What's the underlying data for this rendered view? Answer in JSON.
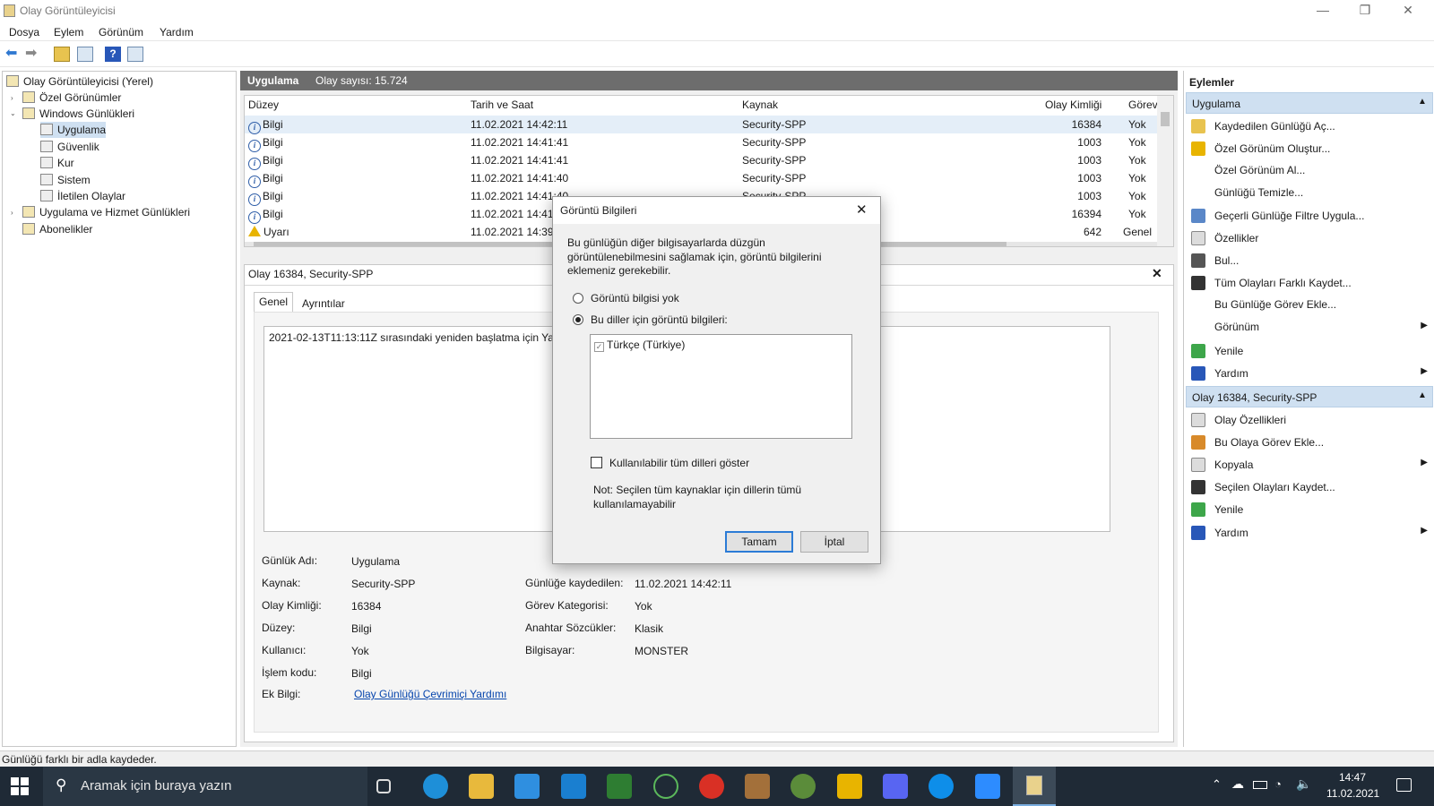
{
  "app": {
    "title": "Olay Görüntüleyicisi"
  },
  "menu": [
    "Dosya",
    "Eylem",
    "Görünüm",
    "Yardım"
  ],
  "tree": {
    "root": "Olay Görüntüleyicisi (Yerel)",
    "custom_views": "Özel Görünümler",
    "windows_logs": "Windows Günlükleri",
    "items": [
      "Uygulama",
      "Güvenlik",
      "Kur",
      "Sistem",
      "İletilen Olaylar"
    ],
    "app_service_logs": "Uygulama ve Hizmet Günlükleri",
    "subscriptions": "Abonelikler"
  },
  "log_header": {
    "name": "Uygulama",
    "count_text": "Olay sayısı: 15.724"
  },
  "grid": {
    "columns": [
      "Düzey",
      "Tarih ve Saat",
      "Kaynak",
      "Olay Kimliği",
      "Görev"
    ],
    "rows": [
      {
        "level": "Bilgi",
        "date": "11.02.2021 14:42:11",
        "source": "Security-SPP",
        "id": "16384",
        "task": "Yok"
      },
      {
        "level": "Bilgi",
        "date": "11.02.2021 14:41:41",
        "source": "Security-SPP",
        "id": "1003",
        "task": "Yok"
      },
      {
        "level": "Bilgi",
        "date": "11.02.2021 14:41:41",
        "source": "Security-SPP",
        "id": "1003",
        "task": "Yok"
      },
      {
        "level": "Bilgi",
        "date": "11.02.2021 14:41:40",
        "source": "Security-SPP",
        "id": "1003",
        "task": "Yok"
      },
      {
        "level": "Bilgi",
        "date": "11.02.2021 14:41:40",
        "source": "Security-SPP",
        "id": "1003",
        "task": "Yok"
      },
      {
        "level": "Bilgi",
        "date": "11.02.2021 14:41:",
        "source": "",
        "id": "16394",
        "task": "Yok"
      },
      {
        "level": "Uyarı",
        "date": "11.02.2021 14:39",
        "source": "",
        "id": "642",
        "task": "Genel"
      }
    ]
  },
  "detail": {
    "title": "Olay 16384, Security-SPP",
    "tabs": [
      "Genel",
      "Ayrıntılar"
    ],
    "message": "2021-02-13T11:13:11Z sırasındaki yeniden başlatma için Ya",
    "labels": {
      "log_name": "Günlük Adı:",
      "source": "Kaynak:",
      "event_id": "Olay Kimliği:",
      "level": "Düzey:",
      "user": "Kullanıcı:",
      "opcode": "İşlem kodu:",
      "more_info": "Ek Bilgi:",
      "logged": "Günlüğe kaydedilen:",
      "task_category": "Görev Kategorisi:",
      "keywords": "Anahtar Sözcükler:",
      "computer": "Bilgisayar:"
    },
    "values": {
      "log_name": "Uygulama",
      "source": "Security-SPP",
      "event_id": "16384",
      "level": "Bilgi",
      "user": "Yok",
      "opcode": "Bilgi",
      "more_info": "Olay Günlüğü Çevrimiçi Yardımı",
      "logged": "11.02.2021 14:42:11",
      "task_category": "Yok",
      "keywords": "Klasik",
      "computer": "MONSTER"
    }
  },
  "actions": {
    "header": "Eylemler",
    "section1": "Uygulama",
    "items1": [
      "Kaydedilen Günlüğü Aç...",
      "Özel Görünüm Oluştur...",
      "Özel Görünüm Al...",
      "Günlüğü Temizle...",
      "Geçerli Günlüğe Filtre Uygula...",
      "Özellikler",
      "Bul...",
      "Tüm Olayları Farklı Kaydet...",
      "Bu Günlüğe Görev Ekle...",
      "Görünüm",
      "Yenile",
      "Yardım"
    ],
    "section2": "Olay 16384, Security-SPP",
    "items2": [
      "Olay Özellikleri",
      "Bu Olaya Görev Ekle...",
      "Kopyala",
      "Seçilen Olayları Kaydet...",
      "Yenile",
      "Yardım"
    ]
  },
  "dialog": {
    "title": "Görüntü Bilgileri",
    "description": "Bu günlüğün diğer bilgisayarlarda düzgün görüntülenebilmesini sağlamak için, görüntü bilgilerini eklemeniz gerekebilir.",
    "option_none": "Görüntü bilgisi yok",
    "option_langs": "Bu diller için görüntü bilgileri:",
    "language": "Türkçe (Türkiye)",
    "show_all": "Kullanılabilir tüm dilleri göster",
    "note": "Not: Seçilen tüm kaynaklar için dillerin tümü kullanılamayabilir",
    "ok": "Tamam",
    "cancel": "İptal"
  },
  "status": {
    "text": "Günlüğü farklı bir adla kaydeder."
  },
  "taskbar": {
    "search_placeholder": "Aramak için buraya yazın",
    "time": "14:47",
    "date": "11.02.2021"
  },
  "colors": {
    "accent": "#cfe0f1",
    "header_bar": "#6d6d6d",
    "taskbar": "#1f2a36",
    "link": "#0645ad"
  }
}
